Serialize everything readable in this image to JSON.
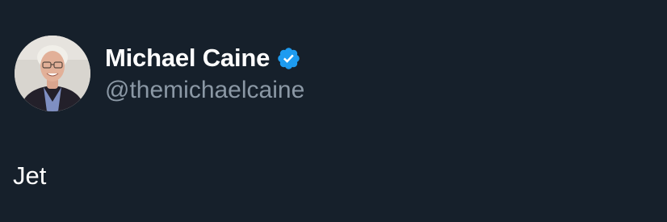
{
  "tweet": {
    "author": {
      "display_name": "Michael Caine",
      "handle": "@themichaelcaine",
      "verified": true,
      "verified_badge_color": "#1d9bf0"
    },
    "text": "Jet"
  },
  "colors": {
    "background": "#16202b",
    "primary_text": "#ffffff",
    "secondary_text": "#8b98a5"
  }
}
